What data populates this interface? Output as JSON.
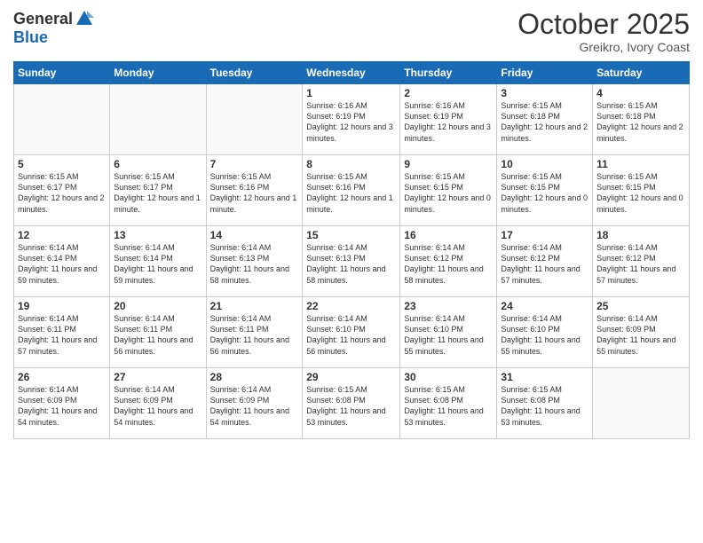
{
  "logo": {
    "general": "General",
    "blue": "Blue"
  },
  "header": {
    "month": "October 2025",
    "location": "Greikro, Ivory Coast"
  },
  "days_of_week": [
    "Sunday",
    "Monday",
    "Tuesday",
    "Wednesday",
    "Thursday",
    "Friday",
    "Saturday"
  ],
  "weeks": [
    [
      {
        "day": "",
        "info": ""
      },
      {
        "day": "",
        "info": ""
      },
      {
        "day": "",
        "info": ""
      },
      {
        "day": "1",
        "info": "Sunrise: 6:16 AM\nSunset: 6:19 PM\nDaylight: 12 hours\nand 3 minutes."
      },
      {
        "day": "2",
        "info": "Sunrise: 6:16 AM\nSunset: 6:19 PM\nDaylight: 12 hours\nand 3 minutes."
      },
      {
        "day": "3",
        "info": "Sunrise: 6:15 AM\nSunset: 6:18 PM\nDaylight: 12 hours\nand 2 minutes."
      },
      {
        "day": "4",
        "info": "Sunrise: 6:15 AM\nSunset: 6:18 PM\nDaylight: 12 hours\nand 2 minutes."
      }
    ],
    [
      {
        "day": "5",
        "info": "Sunrise: 6:15 AM\nSunset: 6:17 PM\nDaylight: 12 hours\nand 2 minutes."
      },
      {
        "day": "6",
        "info": "Sunrise: 6:15 AM\nSunset: 6:17 PM\nDaylight: 12 hours\nand 1 minute."
      },
      {
        "day": "7",
        "info": "Sunrise: 6:15 AM\nSunset: 6:16 PM\nDaylight: 12 hours\nand 1 minute."
      },
      {
        "day": "8",
        "info": "Sunrise: 6:15 AM\nSunset: 6:16 PM\nDaylight: 12 hours\nand 1 minute."
      },
      {
        "day": "9",
        "info": "Sunrise: 6:15 AM\nSunset: 6:15 PM\nDaylight: 12 hours\nand 0 minutes."
      },
      {
        "day": "10",
        "info": "Sunrise: 6:15 AM\nSunset: 6:15 PM\nDaylight: 12 hours\nand 0 minutes."
      },
      {
        "day": "11",
        "info": "Sunrise: 6:15 AM\nSunset: 6:15 PM\nDaylight: 12 hours\nand 0 minutes."
      }
    ],
    [
      {
        "day": "12",
        "info": "Sunrise: 6:14 AM\nSunset: 6:14 PM\nDaylight: 11 hours\nand 59 minutes."
      },
      {
        "day": "13",
        "info": "Sunrise: 6:14 AM\nSunset: 6:14 PM\nDaylight: 11 hours\nand 59 minutes."
      },
      {
        "day": "14",
        "info": "Sunrise: 6:14 AM\nSunset: 6:13 PM\nDaylight: 11 hours\nand 58 minutes."
      },
      {
        "day": "15",
        "info": "Sunrise: 6:14 AM\nSunset: 6:13 PM\nDaylight: 11 hours\nand 58 minutes."
      },
      {
        "day": "16",
        "info": "Sunrise: 6:14 AM\nSunset: 6:12 PM\nDaylight: 11 hours\nand 58 minutes."
      },
      {
        "day": "17",
        "info": "Sunrise: 6:14 AM\nSunset: 6:12 PM\nDaylight: 11 hours\nand 57 minutes."
      },
      {
        "day": "18",
        "info": "Sunrise: 6:14 AM\nSunset: 6:12 PM\nDaylight: 11 hours\nand 57 minutes."
      }
    ],
    [
      {
        "day": "19",
        "info": "Sunrise: 6:14 AM\nSunset: 6:11 PM\nDaylight: 11 hours\nand 57 minutes."
      },
      {
        "day": "20",
        "info": "Sunrise: 6:14 AM\nSunset: 6:11 PM\nDaylight: 11 hours\nand 56 minutes."
      },
      {
        "day": "21",
        "info": "Sunrise: 6:14 AM\nSunset: 6:11 PM\nDaylight: 11 hours\nand 56 minutes."
      },
      {
        "day": "22",
        "info": "Sunrise: 6:14 AM\nSunset: 6:10 PM\nDaylight: 11 hours\nand 56 minutes."
      },
      {
        "day": "23",
        "info": "Sunrise: 6:14 AM\nSunset: 6:10 PM\nDaylight: 11 hours\nand 55 minutes."
      },
      {
        "day": "24",
        "info": "Sunrise: 6:14 AM\nSunset: 6:10 PM\nDaylight: 11 hours\nand 55 minutes."
      },
      {
        "day": "25",
        "info": "Sunrise: 6:14 AM\nSunset: 6:09 PM\nDaylight: 11 hours\nand 55 minutes."
      }
    ],
    [
      {
        "day": "26",
        "info": "Sunrise: 6:14 AM\nSunset: 6:09 PM\nDaylight: 11 hours\nand 54 minutes."
      },
      {
        "day": "27",
        "info": "Sunrise: 6:14 AM\nSunset: 6:09 PM\nDaylight: 11 hours\nand 54 minutes."
      },
      {
        "day": "28",
        "info": "Sunrise: 6:14 AM\nSunset: 6:09 PM\nDaylight: 11 hours\nand 54 minutes."
      },
      {
        "day": "29",
        "info": "Sunrise: 6:15 AM\nSunset: 6:08 PM\nDaylight: 11 hours\nand 53 minutes."
      },
      {
        "day": "30",
        "info": "Sunrise: 6:15 AM\nSunset: 6:08 PM\nDaylight: 11 hours\nand 53 minutes."
      },
      {
        "day": "31",
        "info": "Sunrise: 6:15 AM\nSunset: 6:08 PM\nDaylight: 11 hours\nand 53 minutes."
      },
      {
        "day": "",
        "info": ""
      }
    ]
  ]
}
